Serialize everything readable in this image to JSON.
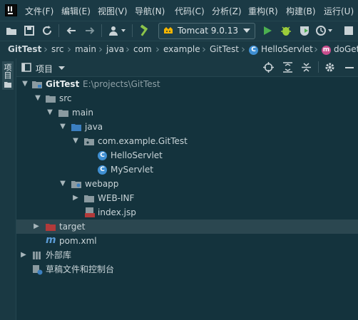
{
  "menu": [
    "文件(F)",
    "编辑(E)",
    "视图(V)",
    "导航(N)",
    "代码(C)",
    "分析(Z)",
    "重构(R)",
    "构建(B)",
    "运行(U)"
  ],
  "toolbar": {
    "run_config": "Tomcat 9.0.13"
  },
  "breadcrumb": [
    "GitTest",
    "src",
    "main",
    "java",
    "com",
    "example",
    "GitTest",
    "HelloServlet",
    "doGet"
  ],
  "side_strip": {
    "label": "项目"
  },
  "project_panel": {
    "title": "项目"
  },
  "tree": {
    "root_name": "GitTest",
    "root_path": "E:\\projects\\GitTest",
    "src": "src",
    "main": "main",
    "java": "java",
    "package": "com.example.GitTest",
    "class1": "HelloServlet",
    "class2": "MyServlet",
    "webapp": "webapp",
    "webinf": "WEB-INF",
    "indexjsp": "index.jsp",
    "target": "target",
    "pom": "pom.xml",
    "external_libs": "外部库",
    "scratches": "草稿文件和控制台"
  },
  "colors": {
    "background": "#14333d",
    "selection": "#2b4750",
    "folder": "#8a9aa0",
    "source_folder": "#3b7fc0",
    "excluded_folder": "#b23a3a",
    "class_icon": "#3f8fd2",
    "run_green": "#4caf50"
  }
}
